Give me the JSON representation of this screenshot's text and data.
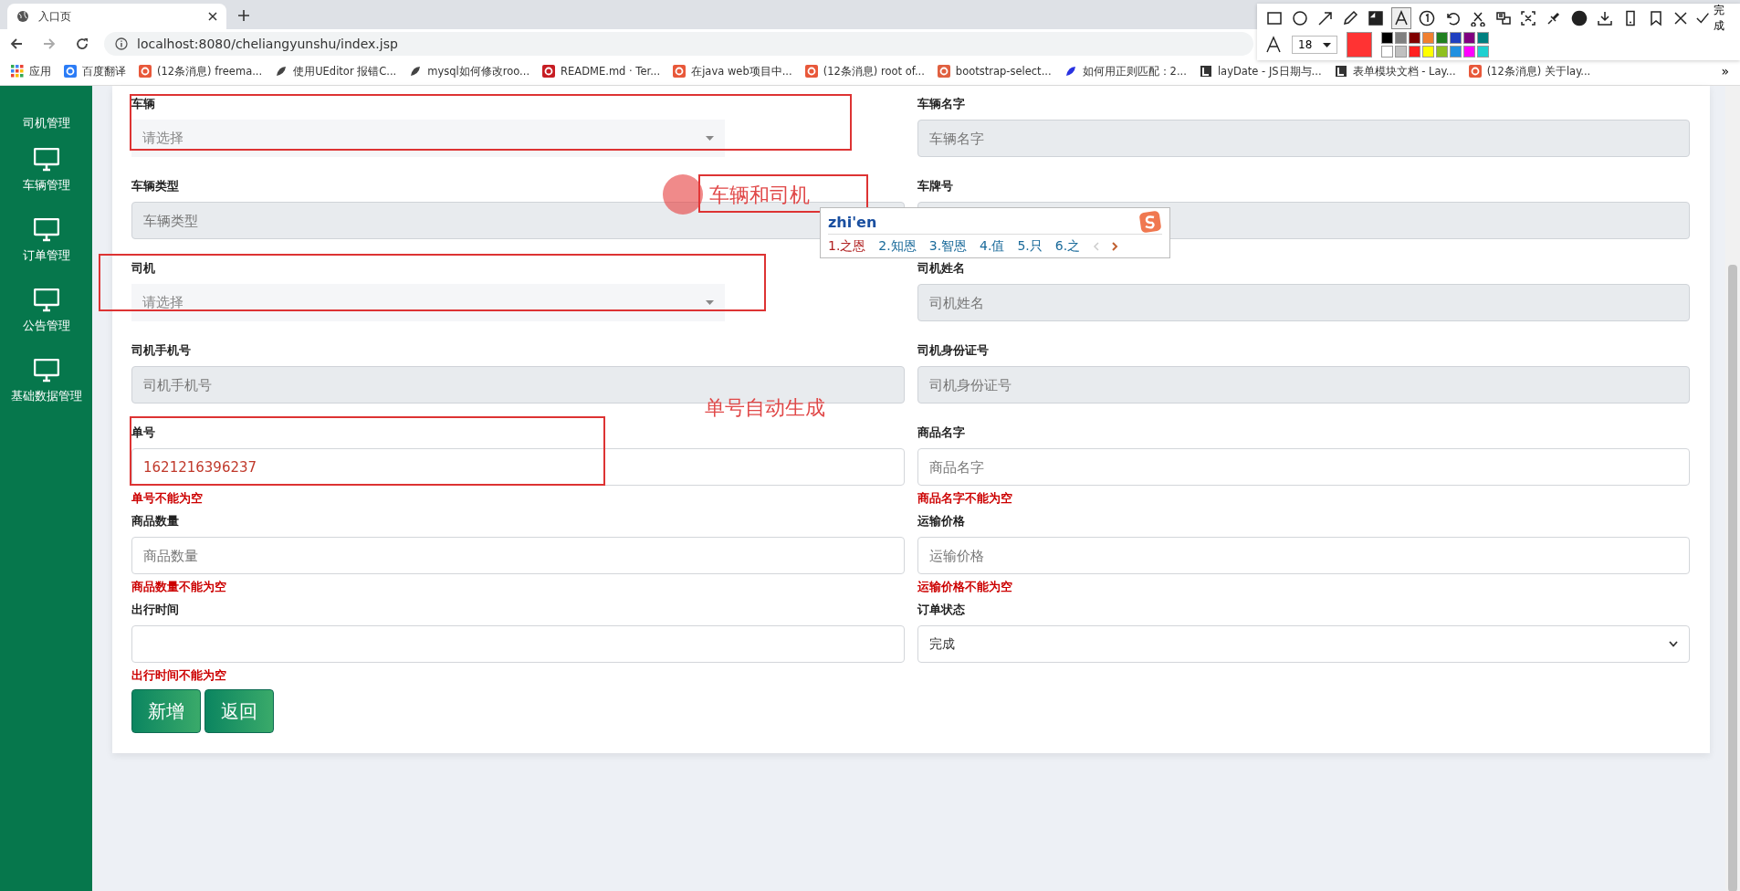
{
  "browser": {
    "tab_title": "入口页",
    "url": "localhost:8080/cheliangyunshu/index.jsp",
    "bookmarks": [
      {
        "kind": "apps",
        "label": "应用"
      },
      {
        "kind": "translate",
        "label": "百度翻译"
      },
      {
        "kind": "csdn",
        "label": "(12条消息) freema..."
      },
      {
        "kind": "leaf",
        "label": "使用UEditor 报错C..."
      },
      {
        "kind": "leaf",
        "label": "mysql如何修改roo..."
      },
      {
        "kind": "gitee",
        "label": "README.md · Ter..."
      },
      {
        "kind": "csdn",
        "label": "在java web项目中..."
      },
      {
        "kind": "csdn",
        "label": "(12条消息) root of..."
      },
      {
        "kind": "jian",
        "label": "bootstrap-select..."
      },
      {
        "kind": "paw",
        "label": "如何用正则匹配：2..."
      },
      {
        "kind": "layui",
        "label": "layDate - JS日期与..."
      },
      {
        "kind": "layui",
        "label": "表单模块文档 - Lay..."
      },
      {
        "kind": "csdn",
        "label": "(12条消息) 关于lay..."
      }
    ],
    "more": "»"
  },
  "sidebar": {
    "items": [
      "司机管理",
      "车辆管理",
      "订单管理",
      "公告管理",
      "基础数据管理"
    ]
  },
  "form": {
    "fields": [
      {
        "label": "车辆",
        "kind": "select",
        "placeholder": "请选择",
        "disabled": false
      },
      {
        "label": "车辆名字",
        "kind": "input",
        "placeholder": "车辆名字",
        "disabled": true
      },
      {
        "label": "车辆类型",
        "kind": "input",
        "placeholder": "车辆类型",
        "disabled": true
      },
      {
        "label": "车牌号",
        "kind": "input",
        "disabled": true
      },
      {
        "label": "司机",
        "kind": "select",
        "placeholder": "请选择",
        "disabled": false
      },
      {
        "label": "司机姓名",
        "kind": "input",
        "placeholder": "司机姓名",
        "disabled": true
      },
      {
        "label": "司机手机号",
        "kind": "input",
        "placeholder": "司机手机号",
        "disabled": true
      },
      {
        "label": "司机身份证号",
        "kind": "input",
        "placeholder": "司机身份证号",
        "disabled": true
      },
      {
        "label": "单号",
        "kind": "input",
        "value": "1621216396237",
        "disabled": false,
        "error": "单号不能为空"
      },
      {
        "label": "商品名字",
        "kind": "input",
        "placeholder": "商品名字",
        "disabled": false,
        "error": "商品名字不能为空"
      },
      {
        "label": "商品数量",
        "kind": "input",
        "placeholder": "商品数量",
        "disabled": false,
        "error": "商品数量不能为空"
      },
      {
        "label": "运输价格",
        "kind": "input",
        "placeholder": "运输价格",
        "disabled": false,
        "error": "运输价格不能为空"
      },
      {
        "label": "出行时间",
        "kind": "input",
        "disabled": false,
        "error": "出行时间不能为空"
      },
      {
        "label": "订单状态",
        "kind": "dropdown",
        "value": "完成",
        "disabled": false
      }
    ],
    "buttons": [
      "新增",
      "返回"
    ]
  },
  "annotations": [
    {
      "kind": "label",
      "text": "车辆和司机"
    },
    {
      "kind": "note",
      "text": "单号自动生成"
    }
  ],
  "ime": {
    "input": "zhi'en",
    "candidates": [
      "1.之恩",
      "2.知恩",
      "3.智恩",
      "4.值",
      "5.只",
      "6.之"
    ]
  },
  "capture_toolbar": {
    "tools": [
      {
        "kind": "rectangle",
        "selected": false
      },
      {
        "kind": "circle",
        "selected": false
      },
      {
        "kind": "arrow",
        "selected": false
      },
      {
        "kind": "pencil",
        "selected": false
      },
      {
        "kind": "mosaic",
        "selected": false
      },
      {
        "kind": "text",
        "selected": true
      },
      {
        "kind": "number",
        "selected": false
      },
      {
        "kind": "undo",
        "selected": false
      },
      {
        "kind": "scissors",
        "selected": false
      },
      {
        "kind": "ocr",
        "selected": false
      },
      {
        "kind": "crop",
        "selected": false
      },
      {
        "kind": "pin",
        "selected": false
      },
      {
        "kind": "record",
        "selected": false
      },
      {
        "kind": "download",
        "selected": false
      },
      {
        "kind": "phone",
        "selected": false
      },
      {
        "kind": "bookmark",
        "selected": false
      },
      {
        "kind": "close",
        "selected": false
      }
    ],
    "done": "完成",
    "font_size": "18",
    "palette": [
      {
        "color": "#000000"
      },
      {
        "color": "#808080"
      },
      {
        "color": "#800000"
      },
      {
        "color": "#f08030"
      },
      {
        "color": "#208020"
      },
      {
        "color": "#2040c0"
      },
      {
        "color": "#800080"
      },
      {
        "color": "#008080"
      },
      {
        "color": "#ffffff"
      },
      {
        "color": "#c0c0c0"
      },
      {
        "color": "#ff2020"
      },
      {
        "color": "#ffff00"
      },
      {
        "color": "#90c020"
      },
      {
        "color": "#2090e0"
      },
      {
        "color": "#ff00ff"
      },
      {
        "color": "#20d0d0"
      }
    ]
  }
}
